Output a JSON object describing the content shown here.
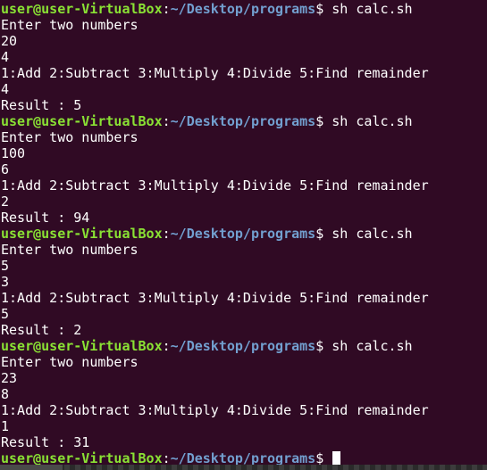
{
  "prompt": {
    "user_host": "user@user-VirtualBox",
    "colon": ":",
    "path": "~/Desktop/programs",
    "dollar": "$ "
  },
  "lines": [
    {
      "type": "prompt",
      "command": "sh calc.sh"
    },
    {
      "type": "output",
      "text": "Enter two numbers"
    },
    {
      "type": "output",
      "text": "20"
    },
    {
      "type": "output",
      "text": "4"
    },
    {
      "type": "output",
      "text": "1:Add 2:Subtract 3:Multiply 4:Divide 5:Find remainder"
    },
    {
      "type": "output",
      "text": "4"
    },
    {
      "type": "output",
      "text": "Result : 5"
    },
    {
      "type": "prompt",
      "command": "sh calc.sh"
    },
    {
      "type": "output",
      "text": "Enter two numbers"
    },
    {
      "type": "output",
      "text": "100"
    },
    {
      "type": "output",
      "text": "6"
    },
    {
      "type": "output",
      "text": "1:Add 2:Subtract 3:Multiply 4:Divide 5:Find remainder"
    },
    {
      "type": "output",
      "text": "2"
    },
    {
      "type": "output",
      "text": "Result : 94"
    },
    {
      "type": "prompt",
      "command": "sh calc.sh"
    },
    {
      "type": "output",
      "text": "Enter two numbers"
    },
    {
      "type": "output",
      "text": "5"
    },
    {
      "type": "output",
      "text": "3"
    },
    {
      "type": "output",
      "text": "1:Add 2:Subtract 3:Multiply 4:Divide 5:Find remainder"
    },
    {
      "type": "output",
      "text": "5"
    },
    {
      "type": "output",
      "text": "Result : 2"
    },
    {
      "type": "prompt",
      "command": "sh calc.sh"
    },
    {
      "type": "output",
      "text": "Enter two numbers"
    },
    {
      "type": "output",
      "text": "23"
    },
    {
      "type": "output",
      "text": "8"
    },
    {
      "type": "output",
      "text": "1:Add 2:Subtract 3:Multiply 4:Divide 5:Find remainder"
    },
    {
      "type": "output",
      "text": "1"
    },
    {
      "type": "output",
      "text": "Result : 31"
    },
    {
      "type": "prompt",
      "command": "",
      "cursor": true
    }
  ],
  "colors": {
    "background": "#300a24",
    "text": "#ffffff",
    "user_host": "#8ae234",
    "path": "#729fcf"
  }
}
